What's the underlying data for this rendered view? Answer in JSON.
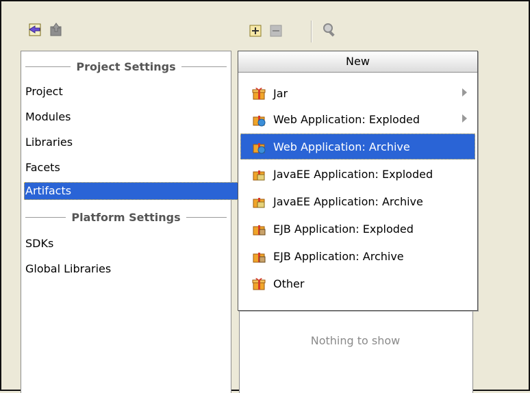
{
  "toolbar": {
    "back_icon": "back-arrow-icon",
    "up_icon": "up-arrow-icon",
    "add_icon": "plus-icon",
    "remove_icon": "minus-icon",
    "search_icon": "magnifier-icon"
  },
  "left": {
    "project_settings_header": "Project Settings",
    "platform_settings_header": "Platform Settings",
    "items": [
      {
        "label": "Project"
      },
      {
        "label": "Modules"
      },
      {
        "label": "Libraries"
      },
      {
        "label": "Facets"
      },
      {
        "label": "Artifacts"
      }
    ],
    "platform_items": [
      {
        "label": "SDKs"
      },
      {
        "label": "Global Libraries"
      }
    ]
  },
  "popup": {
    "title": "New",
    "items": [
      {
        "label": "Jar"
      },
      {
        "label": "Web Application: Exploded"
      },
      {
        "label": "Web Application: Archive"
      },
      {
        "label": "JavaEE Application: Exploded"
      },
      {
        "label": "JavaEE Application: Archive"
      },
      {
        "label": "EJB Application: Exploded"
      },
      {
        "label": "EJB Application: Archive"
      },
      {
        "label": "Other"
      }
    ]
  },
  "main": {
    "empty_text": "Nothing to show"
  },
  "colors": {
    "selection": "#2a64d6",
    "background": "#ece9d8"
  }
}
